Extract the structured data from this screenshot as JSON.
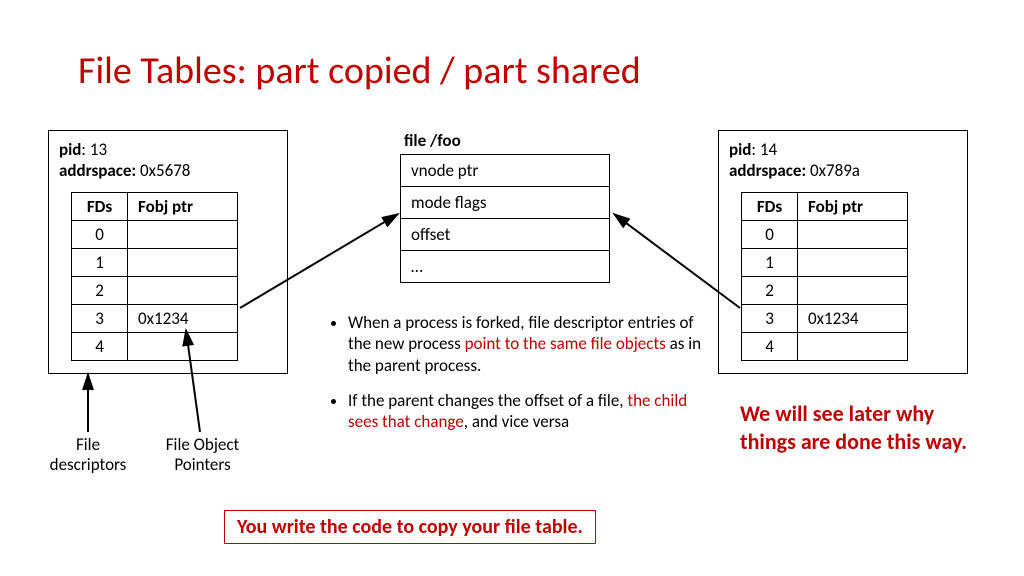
{
  "title": "File Tables: part copied / part shared",
  "proc_left": {
    "pid_label": "pid",
    "pid": "13",
    "addr_label": "addrspace:",
    "addr": "0x5678",
    "h1": "FDs",
    "h2": "Fobj ptr",
    "rows": [
      {
        "fd": "0",
        "ptr": ""
      },
      {
        "fd": "1",
        "ptr": ""
      },
      {
        "fd": "2",
        "ptr": ""
      },
      {
        "fd": "3",
        "ptr": "0x1234"
      },
      {
        "fd": "4",
        "ptr": ""
      }
    ]
  },
  "proc_right": {
    "pid_label": "pid",
    "pid": "14",
    "addr_label": "addrspace:",
    "addr": "0x789a",
    "h1": "FDs",
    "h2": "Fobj ptr",
    "rows": [
      {
        "fd": "0",
        "ptr": ""
      },
      {
        "fd": "1",
        "ptr": ""
      },
      {
        "fd": "2",
        "ptr": ""
      },
      {
        "fd": "3",
        "ptr": "0x1234"
      },
      {
        "fd": "4",
        "ptr": ""
      }
    ]
  },
  "file_box": {
    "label": "file /foo",
    "rows": [
      "vnode ptr",
      "mode flags",
      "offset",
      "…"
    ]
  },
  "bullets": {
    "b1a": "When a process is forked,  file descriptor entries of the new process ",
    "b1b": "point to the same file objects",
    "b1c": " as in the parent process.",
    "b2a": "If the parent changes the offset of a file, ",
    "b2b": "the child sees that change",
    "b2c": ", and vice versa"
  },
  "note": "We will see later why things are done this way.",
  "callout": "You write the code to copy your file table.",
  "annot": {
    "fd": "File descriptors",
    "ptr": "File Object Pointers"
  }
}
